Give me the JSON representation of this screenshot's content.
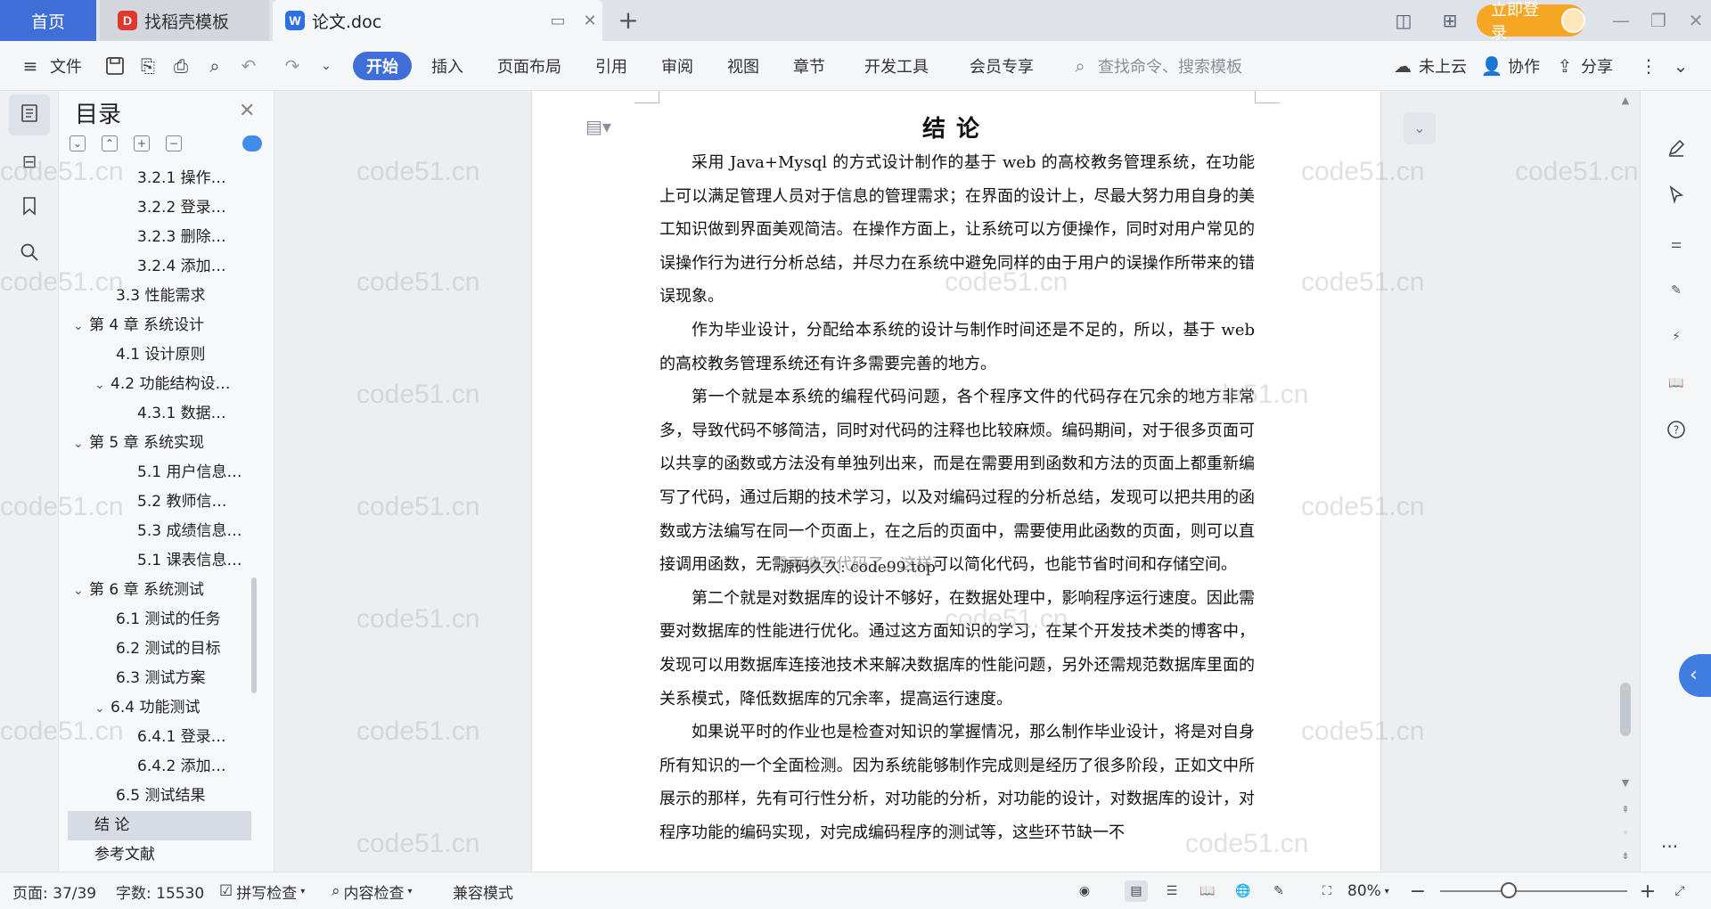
{
  "tabs": {
    "home": "首页",
    "template": "找稻壳模板",
    "doc": "论文.doc"
  },
  "titlebar": {
    "login": "立即登录"
  },
  "toolbar": {
    "file": "文件",
    "menu": [
      "开始",
      "插入",
      "页面布局",
      "引用",
      "审阅",
      "视图",
      "章节",
      "开发工具",
      "会员专享"
    ],
    "search_placeholder": "查找命令、搜索模板",
    "cloud": "未上云",
    "collab": "协作",
    "share": "分享"
  },
  "outline": {
    "title": "目录",
    "items": [
      "3.2.1 操作…",
      "3.2.2 登录…",
      "3.2.3 删除…",
      "3.2.4 添加…",
      "3.3 性能需求",
      "第 4 章 系统设计",
      "4.1 设计原则",
      "4.2 功能结构设…",
      "4.3.1 数据…",
      "第 5 章 系统实现",
      "5.1 用户信息…",
      "5.2 教师信…",
      "5.3 成绩信息…",
      "5.1 课表信息…",
      "第 6 章 系统测试",
      "6.1 测试的任务",
      "6.2 测试的目标",
      "6.3 测试方案",
      "6.4 功能测试",
      "6.4.1 登录…",
      "6.4.2 添加…",
      "6.5 测试结果",
      "结 论",
      "参考文献"
    ]
  },
  "document": {
    "title": "结论",
    "paragraphs": [
      "采用 Java+Mysql 的方式设计制作的基于 web 的高校教务管理系统，在功能上可以满足管理人员对于信息的管理需求；在界面的设计上，尽最大努力用自身的美工知识做到界面美观简洁。在操作方面上，让系统可以方便操作，同时对用户常见的误操作行为进行分析总结，并尽力在系统中避免同样的由于用户的误操作所带来的错误现象。",
      "作为毕业设计，分配给本系统的设计与制作时间还是不足的，所以，基于 web 的高校教务管理系统还有许多需要完善的地方。",
      "第一个就是本系统的编程代码问题，各个程序文件的代码存在冗余的地方非常多，导致代码不够简洁，同时对代码的注释也比较麻烦。编码期间，对于很多页面可以共享的函数或方法没有单独列出来，而是在需要用到函数和方法的页面上都重新编写了代码，通过后期的技术学习，以及对编码过程的分析总结，发现可以把共用的函数或方法编写在同一个页面上，在之后的页面中，需要使用此函数的页面，则可以直接调用函数，无需再编写代码了，这样可以简化代码，也能节省时间和存储空间。",
      "第二个就是对数据库的设计不够好，在数据处理中，影响程序运行速度。因此需要对数据库的性能进行优化。通过这方面知识的学习，在某个开发技术类的博客中，发现可以用数据库连接池技术来解决数据库的性能问题，另外还需规范数据库里面的关系模式，降低数据库的冗余率，提高运行速度。",
      "如果说平时的作业也是检查对知识的掌握情况，那么制作毕业设计，将是对自身所有知识的一个全面检测。因为系统能够制作完成则是经历了很多阶段，正如文中所展示的那样，先有可行性分析，对功能的分析，对功能的设计，对数据库的设计，对程序功能的编码实现，对完成编码程序的测试等，这些环节缺一不"
    ],
    "overlay_label": "源码久久: code99.top",
    "watermark": "code51.cn"
  },
  "statusbar": {
    "page": "页面: 37/39",
    "words": "字数: 15530",
    "spell": "拼写检查",
    "content": "内容检查",
    "compat": "兼容模式",
    "zoom": "80%"
  },
  "colors": {
    "accent": "#3f6ed8",
    "login": "#f5a623"
  }
}
